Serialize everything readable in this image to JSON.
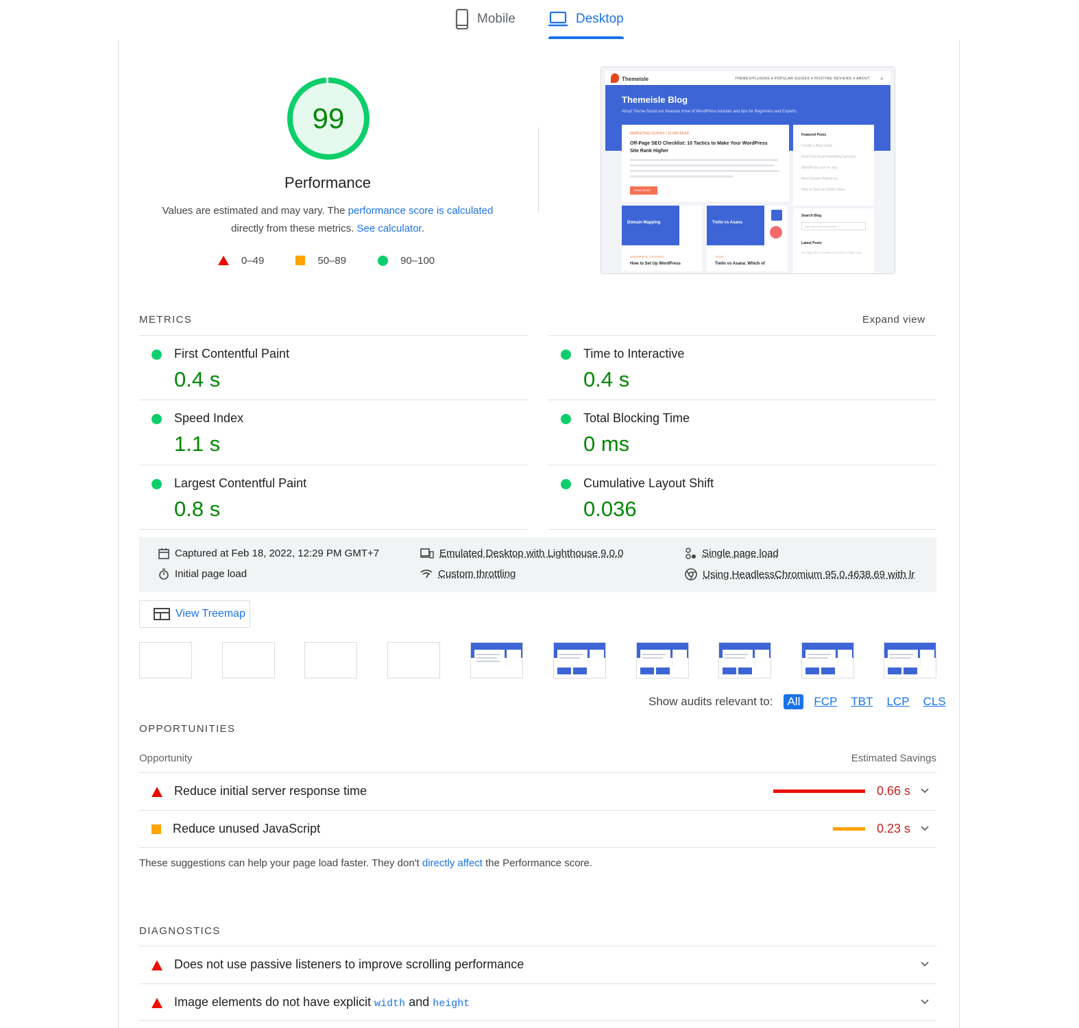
{
  "tabs": {
    "mobile": "Mobile",
    "desktop": "Desktop"
  },
  "gauge": {
    "score": "99",
    "title": "Performance",
    "desc_1": "Values are estimated and may vary. The ",
    "desc_link_1": "performance score is calculated",
    "desc_2": "directly from these metrics. ",
    "desc_link_2": "See calculator",
    "desc_3": ".",
    "legend": {
      "fail": "0–49",
      "average": "50–89",
      "pass": "90–100"
    },
    "color": "#0cce6b"
  },
  "screenshot": {
    "logo": "Themeisle",
    "menu": "THEMES/PLUGINS ▾   POPULAR GUIDES ▾   HOSTING REVIEWS ▾   ABOUT",
    "hero_title": "Themeisle Blog",
    "hero_sub": "Ahoy! You've found our treasure trove of WordPress tutorials and tips for Beginners and Experts.",
    "post_meta": "MARKETING GUIDES  •  10 MIN READ",
    "post_title": "Off-Page SEO Checklist: 10 Tactics to Make Your WordPress Site Rank Higher",
    "read_more": "READ MORE",
    "featured": "Featured Posts",
    "featured_items": [
      "Create a Blog Guide",
      "Best Free Email Marketing Services",
      "WordPress.com vs .org",
      "Best Domain Registrars",
      "How to Start an Online Store"
    ],
    "search_blog": "Search Blog",
    "search_placeholder": "Type here and press enter ...",
    "latest": "Latest Posts",
    "latest_item": "Off-Page SEO Checklist: 10 Tactics to Make Your...",
    "card3_label": "Domain Mapping",
    "card3_meta": "WORDPRESS TUTORIALS",
    "card3_title": "How to Set Up WordPress",
    "card4_label": "Trello vs Asana",
    "card4_meta": "TOOLS",
    "card4_title": "Trello vs Asana: Which of"
  },
  "metrics": {
    "title": "Metrics",
    "expand": "Expand view",
    "items": [
      {
        "label": "First Contentful Paint",
        "value": "0.4 s"
      },
      {
        "label": "Time to Interactive",
        "value": "0.4 s"
      },
      {
        "label": "Speed Index",
        "value": "1.1 s"
      },
      {
        "label": "Total Blocking Time",
        "value": "0 ms"
      },
      {
        "label": "Largest Contentful Paint",
        "value": "0.8 s"
      },
      {
        "label": "Cumulative Layout Shift",
        "value": "0.036"
      }
    ]
  },
  "runtime": {
    "captured": "Captured at Feb 18, 2022, 12:29 PM GMT+7",
    "load": "Initial page load",
    "emulated": "Emulated Desktop with Lighthouse 9.0.0",
    "throttling": "Custom throttling",
    "single": "Single page load",
    "browser": "Using HeadlessChromium 95.0.4638.69 with lr"
  },
  "treemap": "View Treemap",
  "filter": {
    "label": "Show audits relevant to:",
    "options": [
      "All",
      "FCP",
      "TBT",
      "LCP",
      "CLS"
    ]
  },
  "opportunities": {
    "title": "Opportunities",
    "col_left": "Opportunity",
    "col_right": "Estimated Savings",
    "items": [
      {
        "label": "Reduce initial server response time",
        "value": "0.66 s",
        "severity": "fail",
        "bar_color": "#eb0f00",
        "bar_fraction": 1.0
      },
      {
        "label": "Reduce unused JavaScript",
        "value": "0.23 s",
        "severity": "average",
        "bar_color": "#ffa400",
        "bar_fraction": 0.35
      }
    ],
    "note_1": "These suggestions can help your page load faster. They don't ",
    "note_link": "directly affect",
    "note_2": " the Performance score."
  },
  "diagnostics": {
    "title": "Diagnostics",
    "items": [
      {
        "label": "Does not use passive listeners to improve scrolling performance"
      },
      {
        "label_1": "Image elements do not have explicit ",
        "code_1": "width",
        "label_2": " and ",
        "code_2": "height"
      }
    ]
  }
}
